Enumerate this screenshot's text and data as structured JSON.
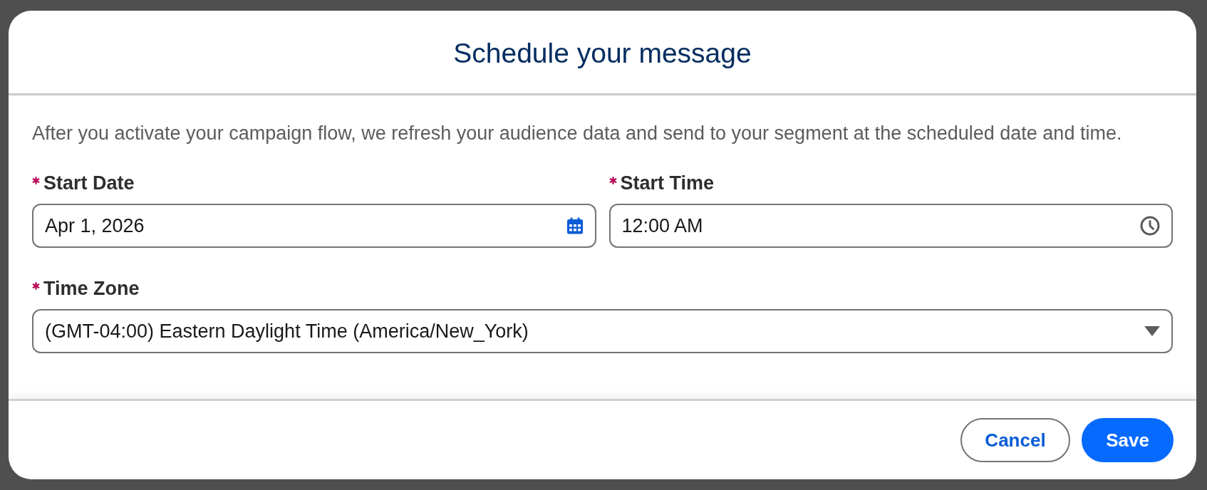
{
  "dialog": {
    "title": "Schedule your message",
    "description": "After you activate your campaign flow, we refresh your audience data and send to your segment at the scheduled date and time.",
    "rows": [
      [
        {
          "kind": "date",
          "label": "Start Date",
          "required": true,
          "value": "Apr 1, 2026"
        },
        {
          "kind": "time",
          "label": "Start Time",
          "required": true,
          "value": "12:00 AM"
        }
      ],
      [
        {
          "kind": "select",
          "label": "Time Zone",
          "required": true,
          "value": "(GMT-04:00) Eastern Daylight Time (America/New_York)"
        }
      ]
    ],
    "buttons": [
      {
        "kind": "neutral",
        "label": "Cancel"
      },
      {
        "kind": "brand",
        "label": "Save"
      }
    ]
  }
}
